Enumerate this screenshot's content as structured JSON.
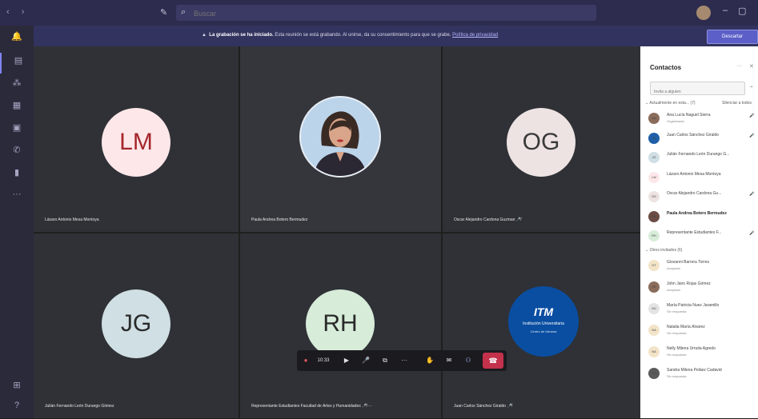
{
  "topbar": {
    "search_placeholder": "Buscar"
  },
  "banner": {
    "bold": "La grabación se ha iniciado.",
    "text": "Esta reunión se está grabando. Al unirse, da su consentimiento para que se grabe.",
    "link": "Política de privacidad",
    "dismiss": "Descartar"
  },
  "tiles": [
    {
      "initials": "LM",
      "name": "Lázaro Antonio Mesa Montoya",
      "avatar_bg": "#fde7e9",
      "avatar_fg": "#a4262c"
    },
    {
      "initials": "",
      "name": "Paula Andrea Botero Bermudez"
    },
    {
      "initials": "OG",
      "name": "Oscar Alejandro Cardona Guzman",
      "avatar_bg": "#ede3e2",
      "avatar_fg": "#3a3a3a"
    },
    {
      "initials": "JG",
      "name": "Julián Fernando León Durango Gómez",
      "avatar_bg": "#cfdfe4",
      "avatar_fg": "#2a2a2a"
    },
    {
      "initials": "RH",
      "name": "Representante Estudiantes Facultad de Artes y Humanidades",
      "avatar_bg": "#d7ecd9",
      "avatar_fg": "#2a2a2a"
    },
    {
      "initials": "",
      "name": "Juan Carlos Sánchez Giraldo"
    }
  ],
  "logo": {
    "mark": "ITM",
    "line1": "Institución Universitaria",
    "line2": "Centro de Idiomas"
  },
  "controls": {
    "timer": "10:33"
  },
  "panel": {
    "title": "Contactos",
    "invite_placeholder": "Invita a alguien",
    "section_current": "Actualmente en esta... (7)",
    "mute_all": "Silenciar a todos",
    "section_others": "Otros invitados (6)",
    "current": [
      {
        "initials": "AN",
        "name": "Ana Lucía Naguel Sierra",
        "status": "Organizador",
        "color": "#8a6c5a"
      },
      {
        "initials": "JS",
        "name": "Juan Carlos Sánchez Giraldo",
        "status": "",
        "color": "#1f5fa8"
      },
      {
        "initials": "JG",
        "name": "Julián Fernando León Durango G...",
        "status": "",
        "color": "#cfdfe4"
      },
      {
        "initials": "LM",
        "name": "Lázaro Antonio Mesa Montoya",
        "status": "",
        "color": "#fde7e9"
      },
      {
        "initials": "OG",
        "name": "Oscar Alejandro Cardona Gu...",
        "status": "",
        "color": "#ede3e2"
      },
      {
        "initials": "PB",
        "name": "Paula Andrea Botero Bermudez",
        "status": "",
        "color": "#6b4d45"
      },
      {
        "initials": "RH",
        "name": "Representante Estudiantes F...",
        "status": "",
        "color": "#d7ecd9"
      }
    ],
    "others": [
      {
        "initials": "GT",
        "name": "Giovanni Barrera Torres",
        "status": "Aceptado",
        "color": "#f3e4c8"
      },
      {
        "initials": "JR",
        "name": "John Jairo Rojas Gómez",
        "status": "Aceptado",
        "color": "#8a6c5a"
      },
      {
        "initials": "MJ",
        "name": "María Patricia Nuez Jaramillo",
        "status": "Sin respuesta",
        "color": "#e3e3e3"
      },
      {
        "initials": "NA",
        "name": "Natalia María Álvarez",
        "status": "Sin respuesta",
        "color": "#f3e4c8"
      },
      {
        "initials": "NA",
        "name": "Nelly Milena Urrutia Agredo",
        "status": "Sin respuesta",
        "color": "#f3e4c8"
      },
      {
        "initials": "SC",
        "name": "Sandra Milena Peláez Cadavid",
        "status": "Sin respuesta",
        "color": "#5a5a5a"
      }
    ]
  }
}
